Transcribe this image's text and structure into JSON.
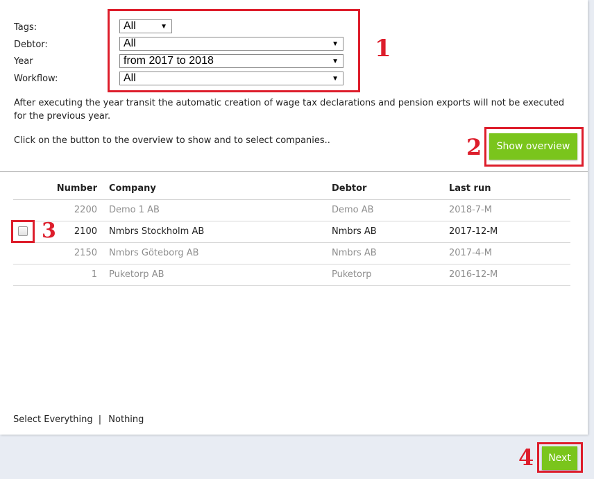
{
  "filters": {
    "tags": {
      "label": "Tags:",
      "value": "All"
    },
    "debtor": {
      "label": "Debtor:",
      "value": "All"
    },
    "year": {
      "label": "Year",
      "value": "from 2017 to 2018"
    },
    "workflow": {
      "label": "Workflow:",
      "value": "All"
    }
  },
  "info_text": "After executing the year transit the automatic creation of wage tax declarations and pension exports will not be executed for the previous year.",
  "instruction_text": "Click on the button to the overview to show and to select companies..",
  "show_overview_label": "Show overview",
  "table": {
    "headers": {
      "number": "Number",
      "company": "Company",
      "debtor": "Debtor",
      "last_run": "Last run"
    },
    "rows": [
      {
        "number": "2200",
        "company": "Demo 1 AB",
        "debtor": "Demo AB",
        "last_run": "2018-7-M"
      },
      {
        "number": "2100",
        "company": "Nmbrs Stockholm AB",
        "debtor": "Nmbrs AB",
        "last_run": "2017-12-M"
      },
      {
        "number": "2150",
        "company": "Nmbrs Göteborg AB",
        "debtor": "Nmbrs AB",
        "last_run": "2017-4-M"
      },
      {
        "number": "1",
        "company": "Puketorp AB",
        "debtor": "Puketorp",
        "last_run": "2016-12-M"
      }
    ]
  },
  "select_everything_label": "Select Everything",
  "separator": "|",
  "nothing_label": "Nothing",
  "next_label": "Next",
  "callouts": {
    "one": "1",
    "two": "2",
    "three": "3",
    "four": "4"
  },
  "icons": {
    "dropdown": "triangle-down"
  },
  "colors": {
    "accent_green": "#7ac51c",
    "annotation_red": "#dd1d2b"
  }
}
